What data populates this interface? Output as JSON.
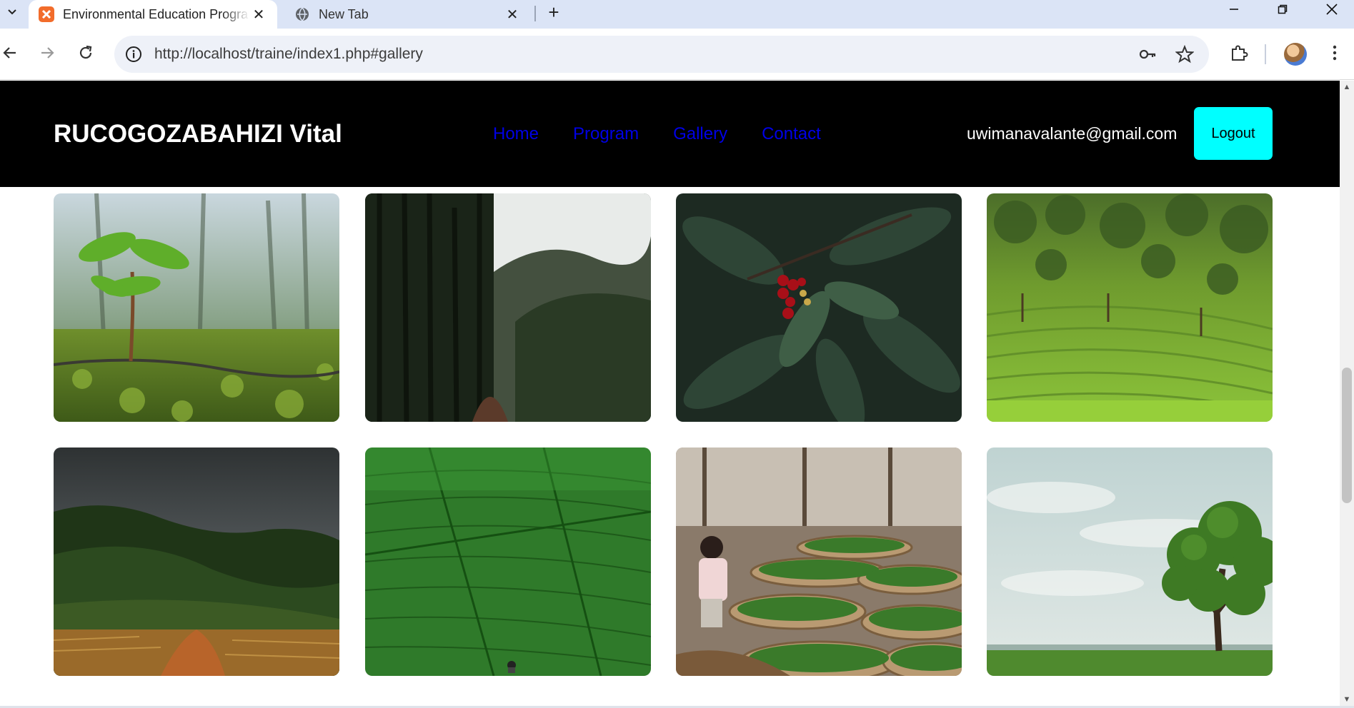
{
  "browser": {
    "tabs": [
      {
        "title": "Environmental Education Progra",
        "active": true,
        "favicon": "xampp-icon"
      },
      {
        "title": "New Tab",
        "active": false,
        "favicon": "globe-icon"
      }
    ],
    "new_tab_symbol": "+",
    "address": {
      "url": "http://localhost/traine/index1.php#gallery"
    },
    "window_controls": [
      "minimize",
      "restore",
      "close"
    ]
  },
  "site": {
    "brand": "RUCOGOZABAHIZI Vital",
    "nav": [
      {
        "label": "Home"
      },
      {
        "label": "Program"
      },
      {
        "label": "Gallery"
      },
      {
        "label": "Contact"
      }
    ],
    "user_email": "uwimanavalante@gmail.com",
    "logout_label": "Logout",
    "colors": {
      "navbar_bg": "#000000",
      "nav_link": "#0000e6",
      "logout_bg": "#00ffff"
    }
  },
  "gallery": {
    "images": [
      {
        "subject": "seedling-sprout-photo"
      },
      {
        "subject": "misty-palm-forest-photo"
      },
      {
        "subject": "coffee-cherries-leaves-photo"
      },
      {
        "subject": "tea-plantation-hillside-photo"
      },
      {
        "subject": "dark-mountain-pineapple-field-photo"
      },
      {
        "subject": "green-tea-field-person-photo"
      },
      {
        "subject": "child-sorting-tea-leaves-photo"
      },
      {
        "subject": "lone-tree-meadow-photo"
      }
    ]
  }
}
